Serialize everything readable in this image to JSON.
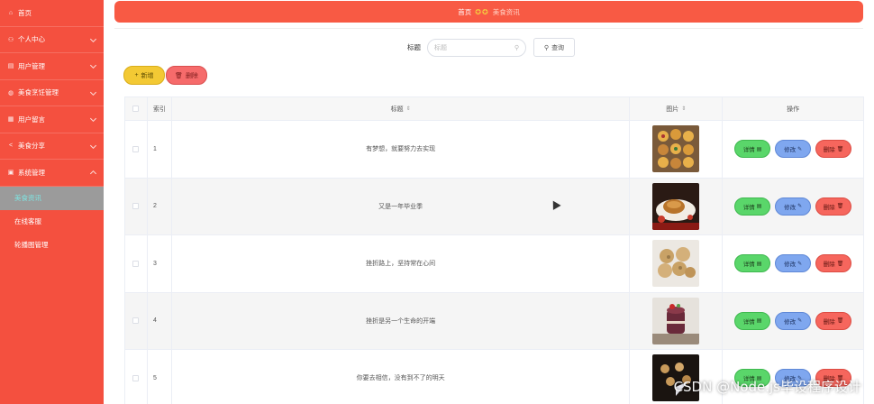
{
  "sidebar": {
    "items": [
      {
        "label": "首页",
        "icon": "home-icon"
      },
      {
        "label": "个人中心",
        "icon": "user-icon"
      },
      {
        "label": "用户管理",
        "icon": "users-icon"
      },
      {
        "label": "美食烹饪管理",
        "icon": "food-icon"
      },
      {
        "label": "用户留言",
        "icon": "message-icon"
      },
      {
        "label": "美食分享",
        "icon": "share-icon"
      },
      {
        "label": "系统管理",
        "icon": "settings-icon"
      }
    ],
    "sub_items": [
      {
        "label": "美食资讯",
        "active": true
      },
      {
        "label": "在线客服",
        "active": false
      },
      {
        "label": "轮播图管理",
        "active": false
      }
    ]
  },
  "breadcrumb": {
    "home": "首页",
    "current": "美食资讯"
  },
  "search": {
    "label": "标题",
    "placeholder": "标题",
    "button_label": "查询"
  },
  "actions": {
    "add_label": "新增",
    "delete_label": "删除"
  },
  "table": {
    "headers": {
      "index": "索引",
      "title": "标题",
      "image": "图片",
      "ops": "操作"
    },
    "op_labels": {
      "detail": "详情",
      "edit": "修改",
      "remove": "删除"
    },
    "rows": [
      {
        "index": "1",
        "title": "有梦想，就要努力去实现"
      },
      {
        "index": "2",
        "title": "又是一年毕业季"
      },
      {
        "index": "3",
        "title": "挫折路上，坚持常在心间"
      },
      {
        "index": "4",
        "title": "挫折是另一个生命的开端"
      },
      {
        "index": "5",
        "title": "你要去相信，没有到不了的明天"
      }
    ]
  },
  "watermark": "CSDN @Node.js毕设程序设计",
  "colors": {
    "sidebar": "#f4503f",
    "banner": "#f85a44",
    "add": "#f3c934",
    "delete": "#f66b6b",
    "detail": "#5ad66a",
    "edit": "#7fa7ef",
    "remove": "#f6665d"
  }
}
